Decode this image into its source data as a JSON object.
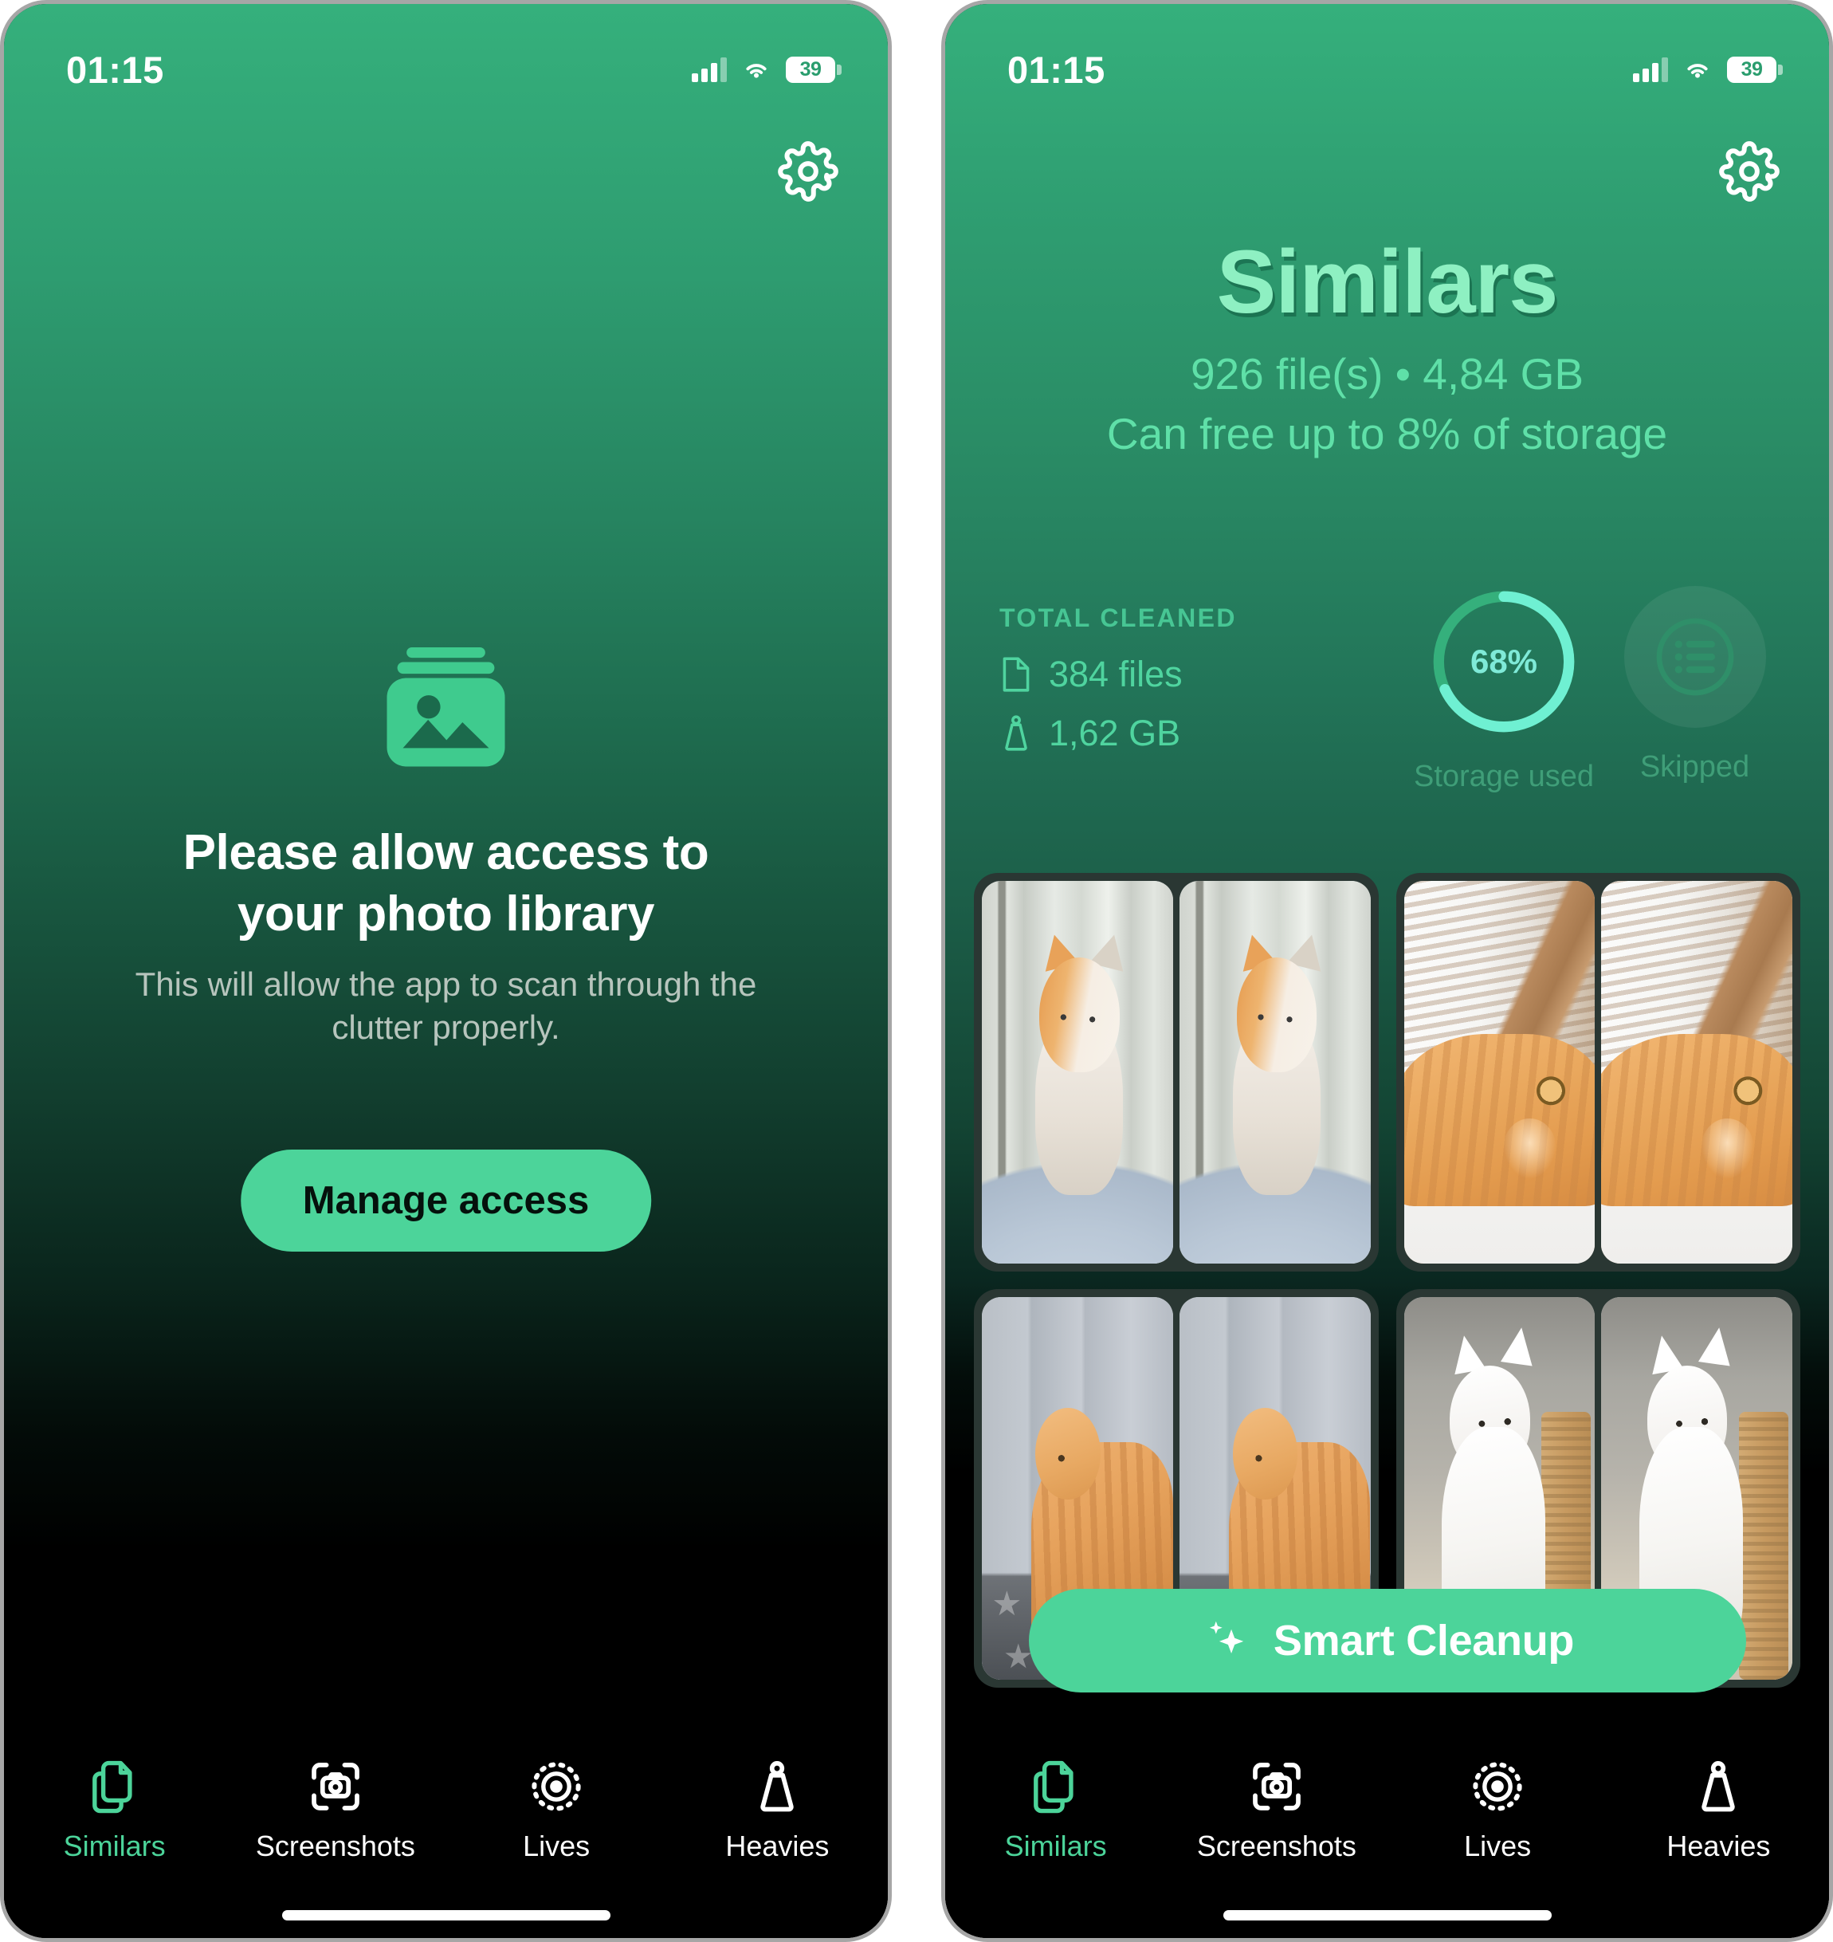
{
  "colors": {
    "accent_green": "#4cd49a",
    "hero_title": "#8ef0c2",
    "hero_sub": "#5fe0a8",
    "stat_text": "#4fd49f",
    "stat_label": "#47c694",
    "ring_track": "#35b07c",
    "ring_progress": "#6ff0d2",
    "caption": "#3f9e78",
    "screen_black": "#000000"
  },
  "status_bar": {
    "time": "01:15",
    "battery_percent": "39",
    "cellular_icon": "cellular-bars-icon",
    "wifi_icon": "wifi-icon",
    "battery_icon": "battery-icon"
  },
  "settings_button": {
    "icon": "gear-icon",
    "label": "Settings"
  },
  "left_screen": {
    "library_icon": "photo-library-icon",
    "title": "Please allow access to your photo library",
    "subtitle": "This will allow the app to scan through the clutter properly.",
    "button_label": "Manage access"
  },
  "right_screen": {
    "hero": {
      "title": "Similars",
      "files_and_size": "926 file(s) • 4,84 GB",
      "free_up": "Can free up to 8% of storage"
    },
    "total_cleaned": {
      "label": "TOTAL CLEANED",
      "files_icon": "document-icon",
      "files_value": "384 files",
      "size_icon": "weight-icon",
      "size_value": "1,62 GB"
    },
    "storage_ring": {
      "percent_label": "68%",
      "percent_value": 68,
      "caption": "Storage used"
    },
    "skipped": {
      "icon": "list-icon",
      "caption": "Skipped"
    },
    "photo_cards": [
      {
        "name": "ginger-white-kitten-window",
        "scene": "scene-a",
        "duplicates": 2
      },
      {
        "name": "ginger-cat-lying-blinds",
        "scene": "scene-b",
        "duplicates": 2
      },
      {
        "name": "ginger-cat-gray-floor",
        "scene": "scene-c",
        "duplicates": 2
      },
      {
        "name": "white-kitten-scratch-post",
        "scene": "scene-d",
        "duplicates": 2
      }
    ],
    "smart_cleanup": {
      "icon": "sparkle-icon",
      "label": "Smart Cleanup"
    }
  },
  "tab_bar": {
    "items": [
      {
        "label": "Similars",
        "icon": "duplicate-files-icon",
        "active": true
      },
      {
        "label": "Screenshots",
        "icon": "screenshot-camera-icon",
        "active": false
      },
      {
        "label": "Lives",
        "icon": "live-photo-icon",
        "active": false
      },
      {
        "label": "Heavies",
        "icon": "weight-icon",
        "active": false
      }
    ]
  }
}
